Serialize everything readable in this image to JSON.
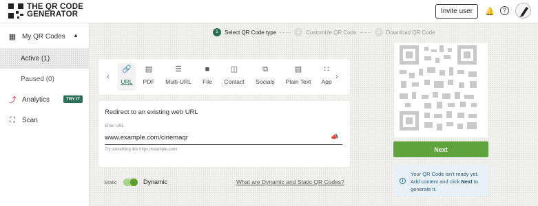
{
  "header": {
    "logo_line1": "THE QR CODE",
    "logo_line2": "GENERATOR",
    "invite_label": "Invite user"
  },
  "sidebar": {
    "items": [
      {
        "label": "My QR Codes",
        "icon": "qr-grid-icon",
        "expanded": true
      },
      {
        "label": "Active (1)",
        "selected": true
      },
      {
        "label": "Paused (0)"
      },
      {
        "label": "Analytics",
        "icon": "analytics-icon",
        "badge": "TRY IT"
      },
      {
        "label": "Scan",
        "icon": "scan-icon"
      }
    ]
  },
  "steps": [
    {
      "num": "1",
      "label": "Select QR Code type",
      "active": true
    },
    {
      "num": "2",
      "label": "Customize QR Code",
      "active": false
    },
    {
      "num": "3",
      "label": "Download QR Code",
      "active": false
    }
  ],
  "types": [
    {
      "label": "URL",
      "icon": "link-icon",
      "active": true
    },
    {
      "label": "PDF",
      "icon": "pdf-icon"
    },
    {
      "label": "Multi-URL",
      "icon": "list-icon"
    },
    {
      "label": "File",
      "icon": "folder-icon"
    },
    {
      "label": "Contact",
      "icon": "contact-card-icon"
    },
    {
      "label": "Socials",
      "icon": "share-icon"
    },
    {
      "label": "Plain Text",
      "icon": "document-icon"
    },
    {
      "label": "App",
      "icon": "apps-grid-icon"
    }
  ],
  "url_form": {
    "title": "Redirect to an existing web URL",
    "field_label": "Enter URL",
    "value": "www.example.com/cinemaqr",
    "hint": "Try something like https://example.com/"
  },
  "toggle": {
    "static_label": "Static",
    "dynamic_label": "Dynamic",
    "link_label": "What are Dynamic and Static QR Codes?",
    "is_dynamic": true
  },
  "preview": {
    "next_label": "Next",
    "info_prefix": "Your QR Code isn't ready yet. Add content and click ",
    "info_bold": "Next",
    "info_suffix": " to generate it."
  },
  "colors": {
    "accent": "#2c6e57",
    "next_button": "#5fa33c",
    "info_bg": "#e7f1f7"
  }
}
